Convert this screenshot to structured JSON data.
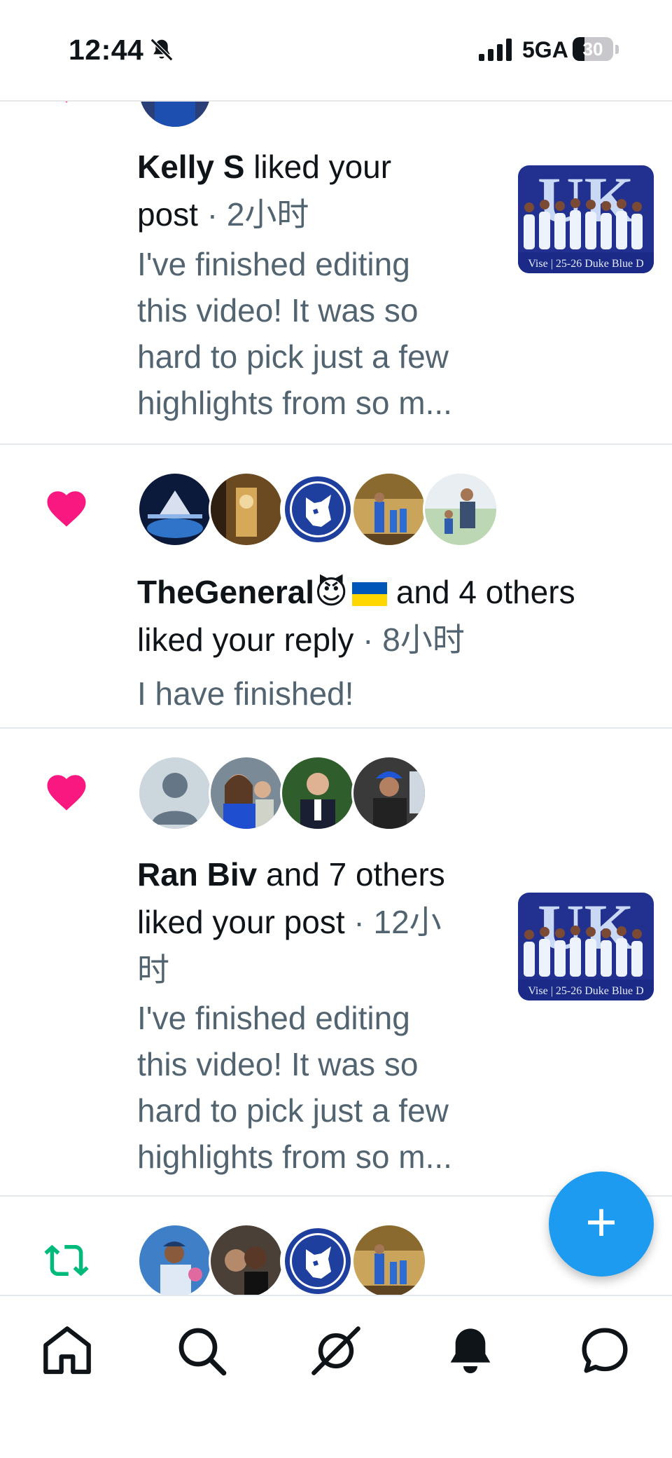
{
  "status_bar": {
    "time": "12:44",
    "network": "5GA",
    "battery_level": "30",
    "battery_fraction": 0.3
  },
  "notifications": [
    {
      "type": "like",
      "actor": "Kelly S",
      "action_line1": " liked your",
      "action_line2": "post",
      "time": " · 2小时",
      "snippet_lines": [
        "I've finished editing",
        "this video! It was so",
        "hard to pick just a few",
        "highlights from so m..."
      ],
      "thumbnail_caption": "Vise | 25-26 Duke Blue D"
    },
    {
      "type": "like",
      "actor": "TheGeneral",
      "actor_emoji": "😈",
      "action_line1": " and 4 others",
      "action_line2": "liked your reply",
      "time": " · 8小时",
      "snippet_lines": [
        "I have finished!"
      ]
    },
    {
      "type": "like",
      "actor": "Ran Biv",
      "action_line1": " and 7 others",
      "action_line2": "liked your post",
      "time": " · 12小",
      "time_cont": "时",
      "snippet_lines": [
        "I've finished editing",
        "this video! It was so",
        "hard to pick just a few",
        "highlights from so m..."
      ],
      "thumbnail_caption": "Vise | 25-26 Duke Blue D"
    },
    {
      "type": "repost"
    }
  ],
  "colors": {
    "like": "#f91880",
    "repost": "#00ba7c",
    "accent": "#1d9bf0",
    "muted": "#536471"
  },
  "fab": {
    "icon": "plus-icon",
    "label": "+"
  },
  "bottom_nav": [
    {
      "name": "home",
      "icon": "home-icon"
    },
    {
      "name": "search",
      "icon": "search-icon"
    },
    {
      "name": "grok",
      "icon": "grok-icon"
    },
    {
      "name": "notifications",
      "icon": "bell-icon",
      "active": true
    },
    {
      "name": "messages",
      "icon": "chat-icon"
    }
  ]
}
